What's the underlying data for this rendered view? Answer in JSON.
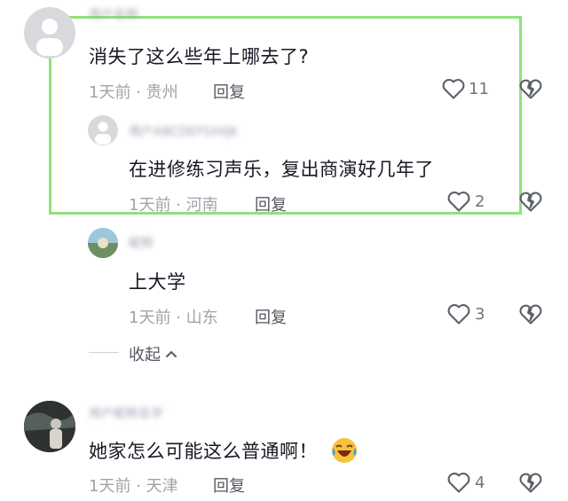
{
  "comments": [
    {
      "text": "消失了这么些年上哪去了?",
      "meta": "1天前 · 贵州",
      "reply_label": "回复",
      "likes": "11",
      "username": "用户名称"
    },
    {
      "text": "在进修练习声乐，复出商演好几年了",
      "meta": "1天前 · 河南",
      "reply_label": "回复",
      "likes": "2",
      "username": "用户ABCDEFGHIJK"
    },
    {
      "text": "上大学",
      "meta": "1天前 · 山东",
      "reply_label": "回复",
      "likes": "3",
      "username": "昵称"
    },
    {
      "text": "她家怎么可能这么普通啊！",
      "meta": "1天前 · 天津",
      "reply_label": "回复",
      "likes": "4",
      "username": "用户昵称名字"
    }
  ],
  "collapse_label": "收起",
  "colors": {
    "highlight": "#8fe27c",
    "meta": "#9fa3aa",
    "text": "#161823"
  }
}
